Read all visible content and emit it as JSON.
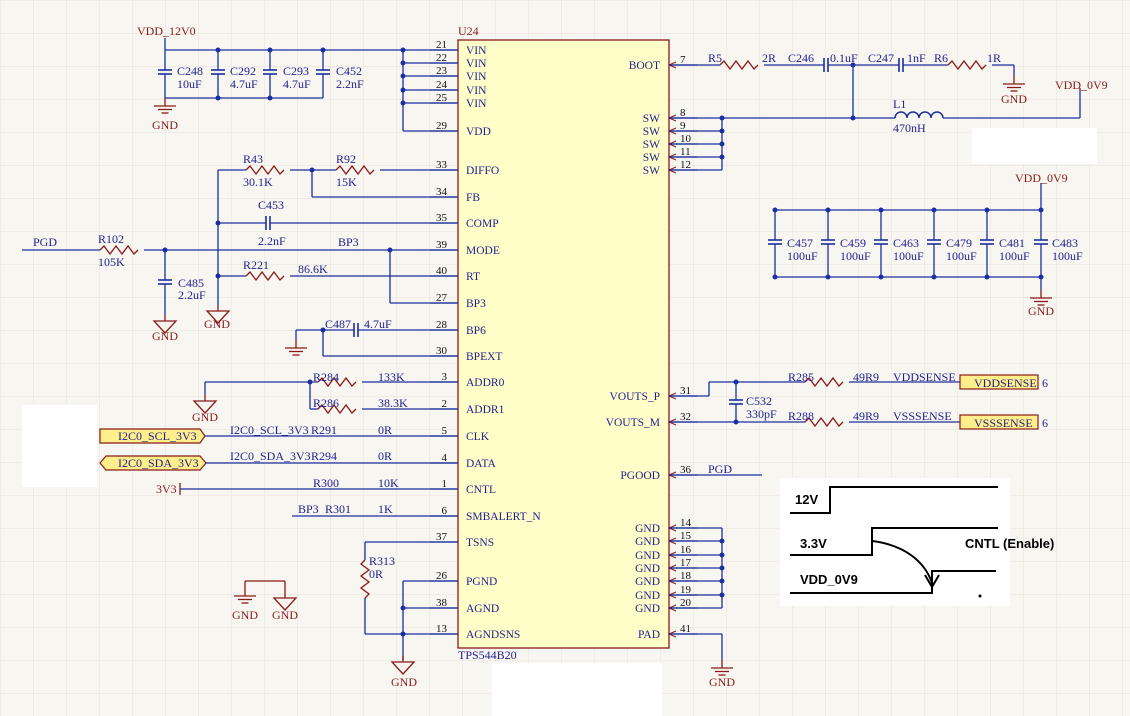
{
  "ic": {
    "ref": "U24",
    "part": "TPS544B20",
    "left_pins": [
      {
        "num": "21",
        "name": "VIN"
      },
      {
        "num": "22",
        "name": "VIN"
      },
      {
        "num": "23",
        "name": "VIN"
      },
      {
        "num": "24",
        "name": "VIN"
      },
      {
        "num": "25",
        "name": "VIN"
      },
      {
        "num": "29",
        "name": "VDD"
      },
      {
        "num": "33",
        "name": "DIFFO"
      },
      {
        "num": "34",
        "name": "FB"
      },
      {
        "num": "35",
        "name": "COMP"
      },
      {
        "num": "39",
        "name": "MODE"
      },
      {
        "num": "40",
        "name": "RT"
      },
      {
        "num": "27",
        "name": "BP3"
      },
      {
        "num": "28",
        "name": "BP6"
      },
      {
        "num": "30",
        "name": "BPEXT"
      },
      {
        "num": "3",
        "name": "ADDR0"
      },
      {
        "num": "2",
        "name": "ADDR1"
      },
      {
        "num": "5",
        "name": "CLK"
      },
      {
        "num": "4",
        "name": "DATA"
      },
      {
        "num": "1",
        "name": "CNTL"
      },
      {
        "num": "6",
        "name": "SMBALERT_N"
      },
      {
        "num": "37",
        "name": "TSNS"
      },
      {
        "num": "26",
        "name": "PGND"
      },
      {
        "num": "38",
        "name": "AGND"
      },
      {
        "num": "13",
        "name": "AGNDSNS"
      }
    ],
    "right_pins": [
      {
        "num": "7",
        "name": "BOOT"
      },
      {
        "num": "8",
        "name": "SW"
      },
      {
        "num": "9",
        "name": "SW"
      },
      {
        "num": "10",
        "name": "SW"
      },
      {
        "num": "11",
        "name": "SW"
      },
      {
        "num": "12",
        "name": "SW"
      },
      {
        "num": "31",
        "name": "VOUTS_P"
      },
      {
        "num": "32",
        "name": "VOUTS_M"
      },
      {
        "num": "36",
        "name": "PGOOD"
      },
      {
        "num": "14",
        "name": "GND"
      },
      {
        "num": "15",
        "name": "GND"
      },
      {
        "num": "16",
        "name": "GND"
      },
      {
        "num": "17",
        "name": "GND"
      },
      {
        "num": "18",
        "name": "GND"
      },
      {
        "num": "19",
        "name": "GND"
      },
      {
        "num": "20",
        "name": "GND"
      },
      {
        "num": "41",
        "name": "PAD"
      }
    ]
  },
  "nets": {
    "vdd12": "VDD_12V0",
    "vdd09": "VDD_0V9",
    "gnd": "GND",
    "pgd": "PGD",
    "bp3": "BP3",
    "v33": "3V3",
    "scl": "I2C0_SCL_3V3",
    "sda": "I2C0_SDA_3V3",
    "vddsense": "VDDSENSE",
    "vsssense": "VSSSENSE",
    "sheet": "6"
  },
  "components": {
    "C248": {
      "ref": "C248",
      "val": "10uF"
    },
    "C292": {
      "ref": "C292",
      "val": "4.7uF"
    },
    "C293": {
      "ref": "C293",
      "val": "4.7uF"
    },
    "C452": {
      "ref": "C452",
      "val": "2.2nF"
    },
    "R43": {
      "ref": "R43",
      "val": "30.1K"
    },
    "R92": {
      "ref": "R92",
      "val": "15K"
    },
    "C453": {
      "ref": "C453",
      "val": "2.2nF"
    },
    "R102": {
      "ref": "R102",
      "val": "105K"
    },
    "C485": {
      "ref": "C485",
      "val": "2.2uF"
    },
    "R221": {
      "ref": "R221",
      "val": "86.6K"
    },
    "C487": {
      "ref": "C487",
      "val": "4.7uF"
    },
    "R284": {
      "ref": "R284",
      "val": "133K"
    },
    "R286": {
      "ref": "R286",
      "val": "38.3K"
    },
    "R291": {
      "ref": "R291",
      "val": "0R"
    },
    "R294": {
      "ref": "R294",
      "val": "0R"
    },
    "R300": {
      "ref": "R300",
      "val": "10K"
    },
    "R301": {
      "ref": "R301",
      "val": "1K"
    },
    "R313": {
      "ref": "R313",
      "val": "0R"
    },
    "R5": {
      "ref": "R5",
      "val": "2R"
    },
    "C246": {
      "ref": "C246",
      "val": "0.1uF"
    },
    "C247": {
      "ref": "C247",
      "val": "1nF"
    },
    "R6": {
      "ref": "R6",
      "val": "1R"
    },
    "L1": {
      "ref": "L1",
      "val": "470nH"
    },
    "C457": {
      "ref": "C457",
      "val": "100uF"
    },
    "C459": {
      "ref": "C459",
      "val": "100uF"
    },
    "C463": {
      "ref": "C463",
      "val": "100uF"
    },
    "C479": {
      "ref": "C479",
      "val": "100uF"
    },
    "C481": {
      "ref": "C481",
      "val": "100uF"
    },
    "C483": {
      "ref": "C483",
      "val": "100uF"
    },
    "C532": {
      "ref": "C532",
      "val": "330pF"
    },
    "R285": {
      "ref": "R285",
      "val": "49R9"
    },
    "R288": {
      "ref": "R288",
      "val": "49R9"
    }
  },
  "sequence": {
    "v12": "12V",
    "v33": "3.3V",
    "v09": "VDD_0V9",
    "cntl": "CNTL (Enable)"
  }
}
